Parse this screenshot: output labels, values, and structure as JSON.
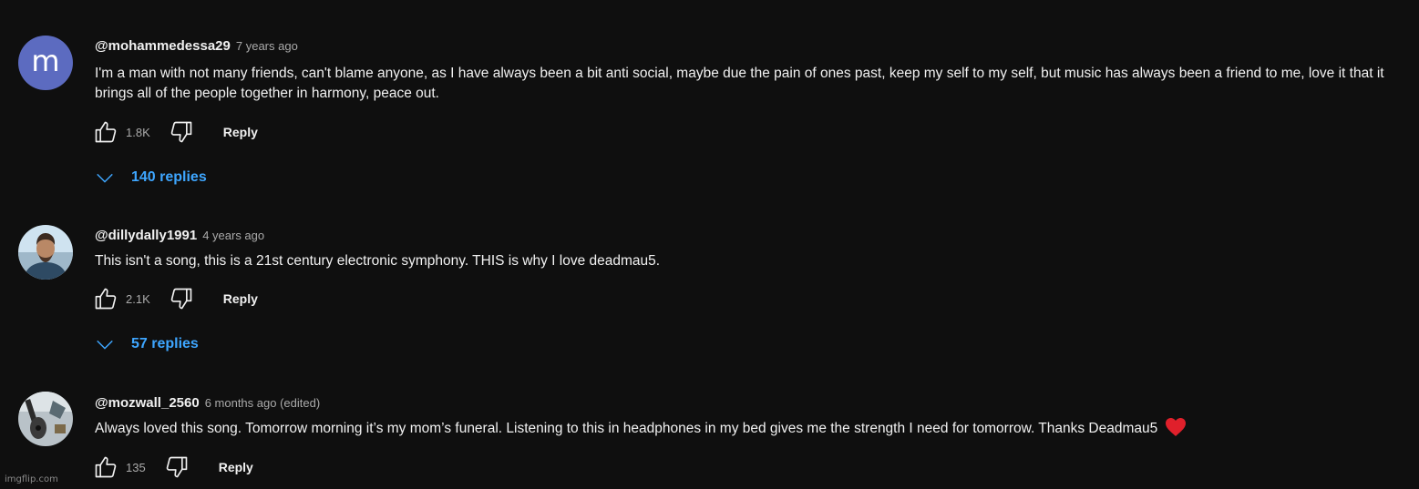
{
  "comments": [
    {
      "author": "@mohammedessa29",
      "time": "7 years ago",
      "avatar_letter": "m",
      "text": "I'm a man with not many friends, can't blame anyone, as I have always been a bit anti social, maybe due the pain of ones past, keep my self to my self, but music has always been a friend to me, love it that it brings all of the people together in harmony, peace out.",
      "likes": "1.8K",
      "reply_label": "Reply",
      "replies_label": "140 replies"
    },
    {
      "author": "@dillydally1991",
      "time": "4 years ago",
      "text": "This isn't a song, this is a 21st century electronic symphony. THIS is why I love deadmau5.",
      "likes": "2.1K",
      "reply_label": "Reply",
      "replies_label": "57 replies"
    },
    {
      "author": "@mozwall_2560",
      "time": "6 months ago (edited)",
      "text": "Always loved this song. Tomorrow morning it’s my mom’s funeral. Listening to this in headphones in my bed gives me the strength I need for tomorrow. Thanks Deadmau5",
      "likes": "135",
      "reply_label": "Reply"
    }
  ],
  "watermark": "imgflip.com",
  "colors": {
    "background": "#0f0f0f",
    "link_blue": "#3ea6ff",
    "avatar_m": "#5c6bc0",
    "heart": "#e0202b"
  }
}
